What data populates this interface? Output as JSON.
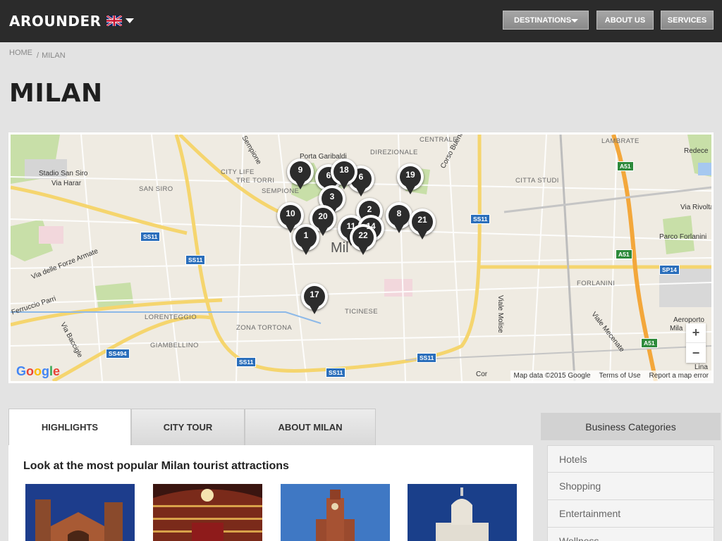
{
  "header": {
    "logo": "AROUNDER",
    "language_icon": "uk-flag-icon",
    "nav": {
      "destinations": "DESTINATIONS",
      "about_us": "ABOUT US",
      "services": "SERVICES"
    }
  },
  "breadcrumb": {
    "home": "HOME",
    "separator": "/",
    "current": "MILAN"
  },
  "page_title": "MILAN",
  "map": {
    "labels": {
      "stadio": "Stadio San Siro",
      "via_harar": "Via Harar",
      "san_siro": "SAN SIRO",
      "city_life": "CITY LIFE",
      "tre_torri": "TRE TORRI",
      "sempione": "SEMPIONE",
      "porta_garibaldi": "Porta Garibaldi",
      "direzionale": "DIREZIONALE",
      "centrale": "CENTRALE",
      "corso_buenos_aires": "Corso Buenos Aires",
      "citta_studi": "CITTA STUDI",
      "lambrate": "LAMBRATE",
      "redece": "Redece",
      "via_rivoltana": "Via Rivoltar",
      "parco_forlanini": "Parco Forlanini",
      "forlanini": "FORLANINI",
      "milano": "Mil",
      "via_forze_armate": "Via delle Forze Armate",
      "ferruccio_parri": "Ferruccio Parri",
      "lorenteggio": "LORENTEGGIO",
      "zona_tortona": "ZONA TORTONA",
      "ticinese": "TICINESE",
      "giambellino": "GIAMBELLINO",
      "via_baggio": "Via Baccigle",
      "viale_molise": "Viale Molise",
      "viale_mecenate": "Viale Mecenate",
      "aeroporto": "Aeroporto",
      "aeroporto_2": "Mila",
      "linate": "Lina",
      "sempione_road": "Sempione",
      "porta_romana": "Cor"
    },
    "road_signs": [
      "SS11",
      "SS11",
      "SS11",
      "SS11",
      "SS11",
      "SS494",
      "SS11",
      "SS11"
    ],
    "green_signs": [
      "A51",
      "A51",
      "A51"
    ],
    "sp14": "SP14",
    "pins": [
      "9",
      "6",
      "18",
      "6",
      "19",
      "3",
      "2",
      "8",
      "21",
      "10",
      "20",
      "11",
      "14",
      "1",
      "22",
      "17"
    ],
    "attribution": {
      "data": "Map data ©2015 Google",
      "terms": "Terms of Use",
      "report": "Report a map error"
    },
    "zoom_in": "+",
    "zoom_out": "−"
  },
  "tabs": [
    {
      "label": "HIGHLIGHTS",
      "active": true
    },
    {
      "label": "CITY TOUR",
      "active": false
    },
    {
      "label": "ABOUT MILAN",
      "active": false
    }
  ],
  "content": {
    "title": "Look at the most popular Milan tourist attractions"
  },
  "sidebar": {
    "header": "Business Categories",
    "categories": [
      "Hotels",
      "Shopping",
      "Entertainment",
      "Wellness"
    ]
  }
}
